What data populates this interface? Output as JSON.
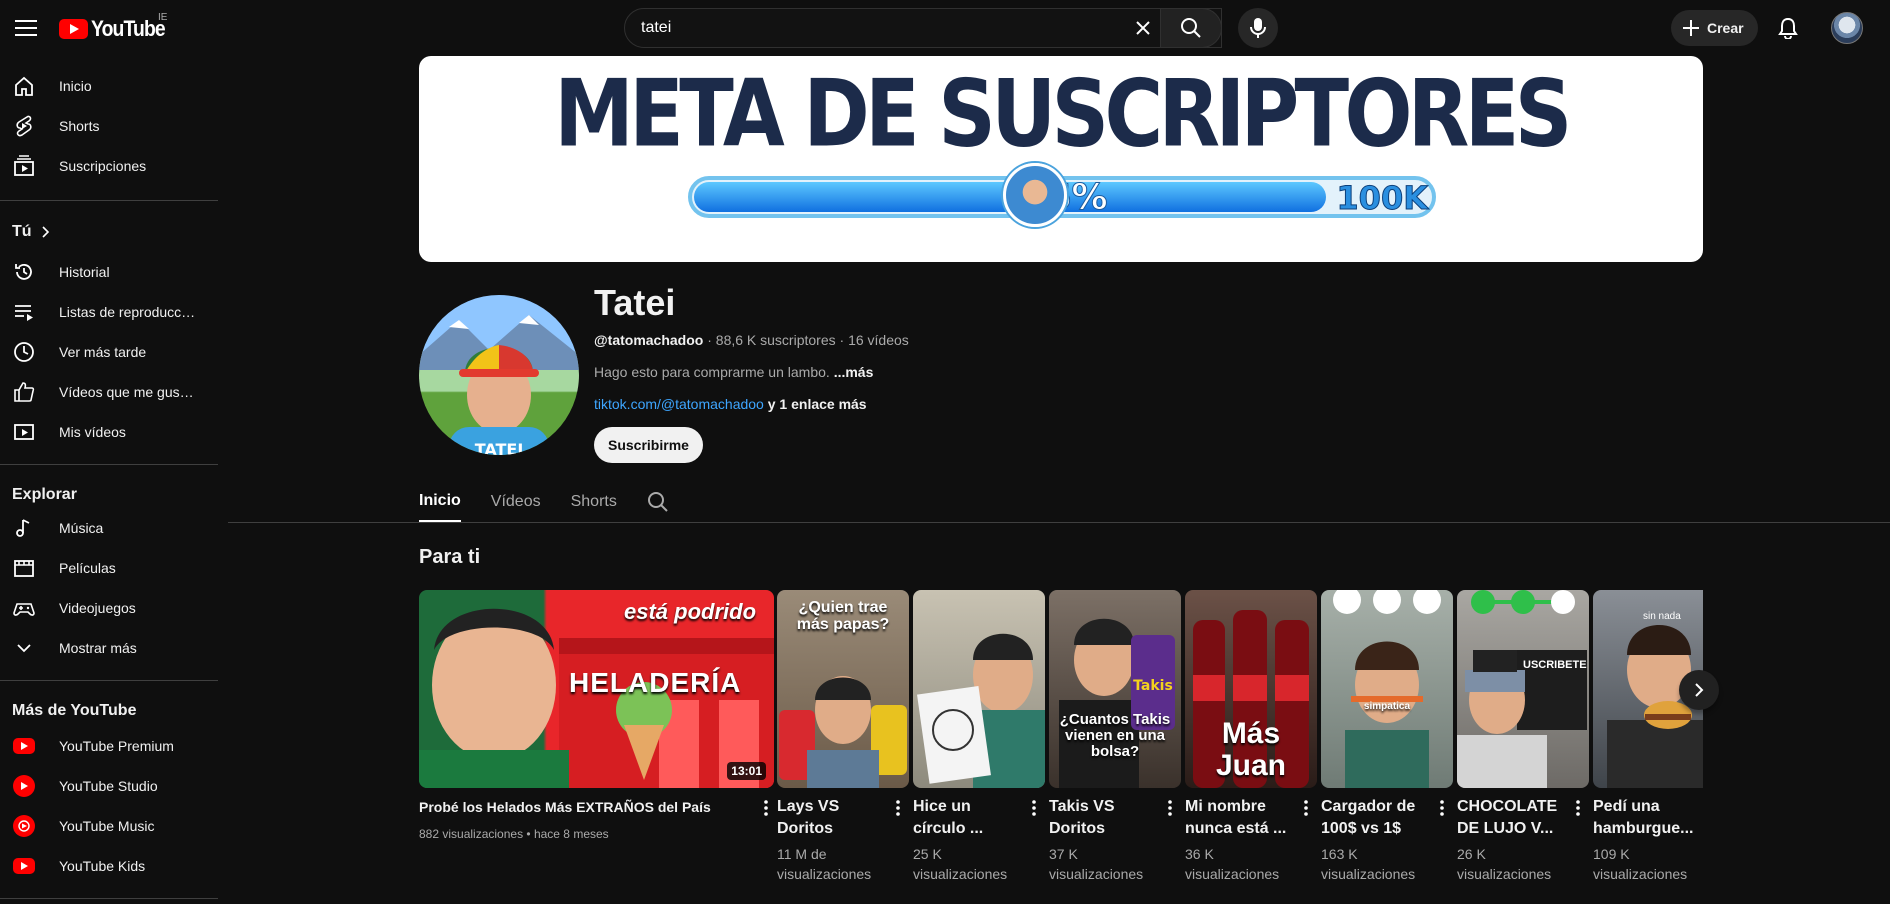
{
  "header": {
    "logo_text": "YouTube",
    "region": "IE",
    "search_value": "tatei",
    "create_label": "Crear"
  },
  "sidebar": {
    "main": [
      {
        "label": "Inicio",
        "icon": "home-icon"
      },
      {
        "label": "Shorts",
        "icon": "shorts-icon"
      },
      {
        "label": "Suscripciones",
        "icon": "subscriptions-icon"
      }
    ],
    "you_heading": "Tú",
    "you": [
      {
        "label": "Historial",
        "icon": "history-icon"
      },
      {
        "label": "Listas de reproducc…",
        "icon": "playlists-icon"
      },
      {
        "label": "Ver más tarde",
        "icon": "watch-later-icon"
      },
      {
        "label": "Vídeos que me gus…",
        "icon": "thumbs-up-icon"
      },
      {
        "label": "Mis vídeos",
        "icon": "my-videos-icon"
      }
    ],
    "explore_heading": "Explorar",
    "explore": [
      {
        "label": "Música",
        "icon": "music-icon"
      },
      {
        "label": "Películas",
        "icon": "movies-icon"
      },
      {
        "label": "Videojuegos",
        "icon": "gaming-icon"
      },
      {
        "label": "Mostrar más",
        "icon": "chevron-down-icon"
      }
    ],
    "more_heading": "Más de YouTube",
    "more": [
      {
        "label": "YouTube Premium",
        "icon": "youtube-premium-icon"
      },
      {
        "label": "YouTube Studio",
        "icon": "youtube-studio-icon"
      },
      {
        "label": "YouTube Music",
        "icon": "youtube-music-icon"
      },
      {
        "label": "YouTube Kids",
        "icon": "youtube-kids-icon"
      }
    ]
  },
  "banner": {
    "title": "META DE SUSCRIPTORES",
    "progress_percent": 86,
    "progress_label": "86%",
    "goal_label": "100K"
  },
  "channel": {
    "name": "Tatei",
    "handle": "@tatomachadoo",
    "subscribers": "88,6 K suscriptores",
    "videos": "16 vídeos",
    "description": "Hago esto para comprarme un lambo.",
    "more_label": "...más",
    "link": "tiktok.com/@tatomachadoo",
    "more_links": "y 1 enlace más",
    "subscribe_label": "Suscribirme"
  },
  "tabs": [
    "Inicio",
    "Vídeos",
    "Shorts"
  ],
  "section_title": "Para ti",
  "featured": {
    "title": "Probé los Helados Más EXTRAÑOS del País",
    "views": "882 visualizaciones",
    "age": "hace 8 meses",
    "duration": "13:01",
    "overlay_text": "está podrido",
    "sign_text": "HELADERÍA"
  },
  "shorts": [
    {
      "title_l1": "Lays VS",
      "title_l2": "Doritos",
      "views_l1": "11 M de",
      "views_l2": "visualizaciones",
      "overlay": "¿Quien trae más papas?"
    },
    {
      "title_l1": "Hice un",
      "title_l2": "círculo ...",
      "views_l1": "25 K",
      "views_l2": "visualizaciones",
      "overlay": ""
    },
    {
      "title_l1": "Takis VS",
      "title_l2": "Doritos",
      "views_l1": "37 K",
      "views_l2": "visualizaciones",
      "overlay": "¿Cuantos Takis vienen en una bolsa?"
    },
    {
      "title_l1": "Mi nombre",
      "title_l2": "nunca está ...",
      "views_l1": "36 K",
      "views_l2": "visualizaciones",
      "overlay": "Más Juan"
    },
    {
      "title_l1": "Cargador de",
      "title_l2": "100$ vs 1$",
      "views_l1": "163 K",
      "views_l2": "visualizaciones",
      "overlay": "simpatica"
    },
    {
      "title_l1": "CHOCOLATE",
      "title_l2": "DE LUJO V...",
      "views_l1": "26 K",
      "views_l2": "visualizaciones",
      "overlay": "USCRIBETE"
    },
    {
      "title_l1": "Pedí una",
      "title_l2": "hamburgue...",
      "views_l1": "109 K",
      "views_l2": "visualizaciones",
      "overlay": "sin nada"
    }
  ]
}
